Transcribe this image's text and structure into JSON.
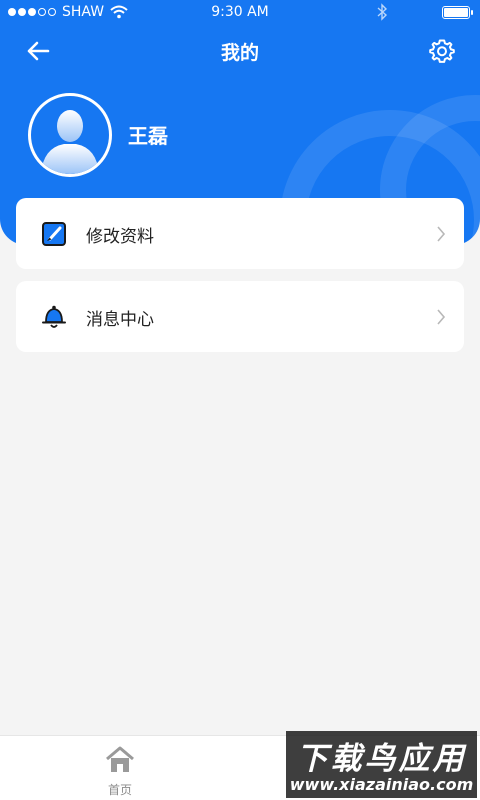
{
  "status_bar": {
    "carrier": "SHAW",
    "time": "9:30 AM",
    "battery_level": 1.0,
    "signal_bars_filled": 3,
    "signal_bars_total": 5
  },
  "header": {
    "title": "我的",
    "back_icon": "arrow-left-icon",
    "settings_icon": "gear-icon"
  },
  "profile": {
    "name": "王磊",
    "avatar_icon": "user-silhouette-icon"
  },
  "menu": {
    "items": [
      {
        "label": "修改资料",
        "icon": "edit-note-icon"
      },
      {
        "label": "消息中心",
        "icon": "bell-icon"
      }
    ]
  },
  "tabbar": {
    "home_label": "首页",
    "home_icon": "home-icon"
  },
  "watermark": {
    "main": "下载鸟应用",
    "sub": "www.xiazainiao.com"
  },
  "colors": {
    "primary": "#1677f2",
    "background": "#f4f4f4",
    "text": "#222222",
    "muted": "#8c8c8c"
  }
}
